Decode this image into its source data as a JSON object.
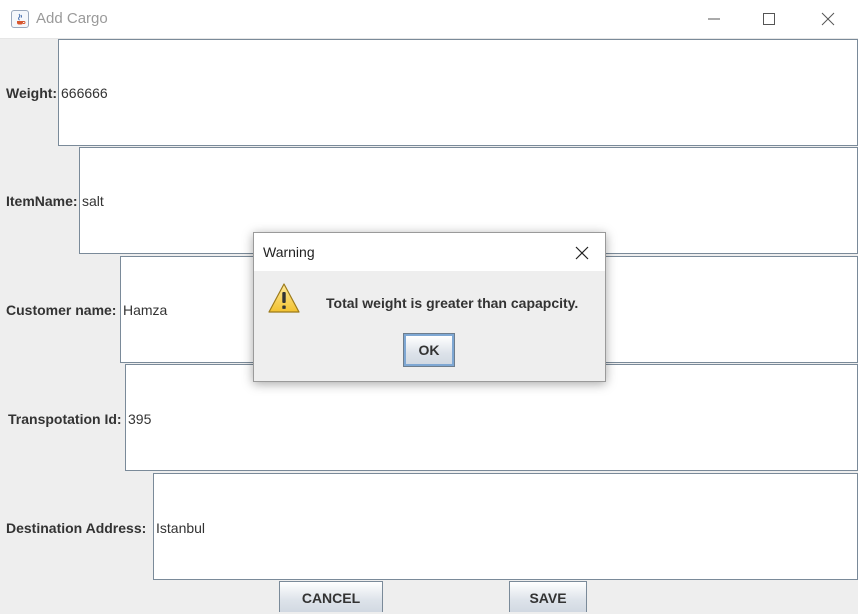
{
  "window": {
    "title": "Add Cargo"
  },
  "form": {
    "fields": [
      {
        "label": "Weight:",
        "value": "666666"
      },
      {
        "label": "ItemName:",
        "value": "salt"
      },
      {
        "label": "Customer name:",
        "value": "Hamza"
      },
      {
        "label": "Transpotation Id:",
        "value": "395"
      },
      {
        "label": "Destination Address:",
        "value": "Istanbul"
      }
    ]
  },
  "buttons": {
    "cancel_label": "CANCEL",
    "save_label": "SAVE"
  },
  "dialog": {
    "title": "Warning",
    "message": "Total weight is greater than capapcity.",
    "ok_label": "OK",
    "icon": "warning-icon"
  },
  "colors": {
    "window_bg": "#eeeeee",
    "field_border": "#7a8a99",
    "warning_yellow": "#f2c230"
  }
}
